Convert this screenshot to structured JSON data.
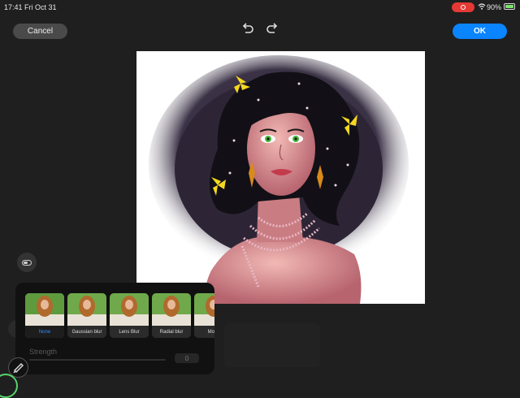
{
  "status_bar": {
    "time": "17:41",
    "date": "Fri Oct 31",
    "battery": "90%"
  },
  "toolbar": {
    "cancel_label": "Cancel",
    "ok_label": "OK"
  },
  "blur_panel": {
    "options": [
      {
        "label": "None",
        "selected": true
      },
      {
        "label": "Gaussian blur",
        "selected": false
      },
      {
        "label": "Lens Blur",
        "selected": false
      },
      {
        "label": "Radial blur",
        "selected": false
      },
      {
        "label": "Motio",
        "selected": false
      }
    ],
    "strength_label": "Strength",
    "strength_value": "0"
  },
  "colors": {
    "accent": "#0a84ff",
    "record": "#e53935",
    "battery": "#7be36a",
    "panel": "#111111"
  }
}
